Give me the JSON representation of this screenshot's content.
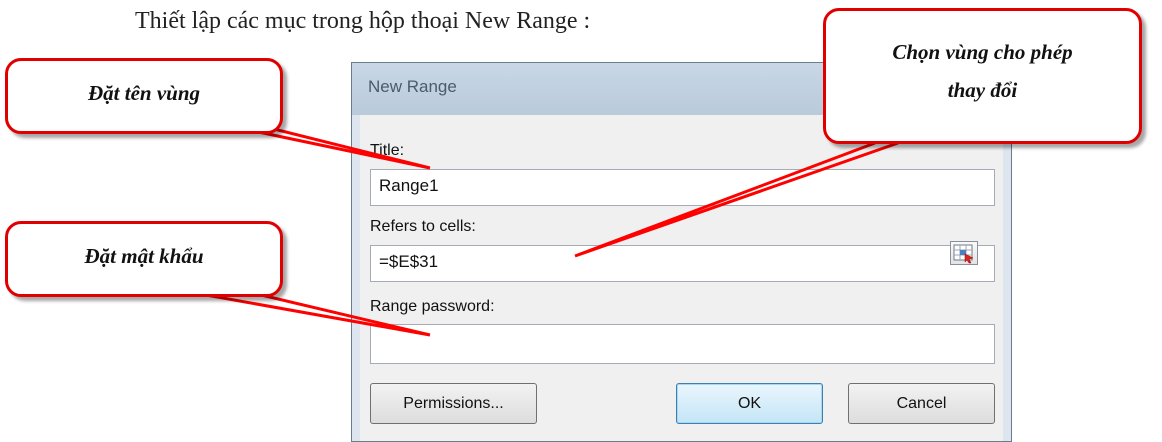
{
  "heading": "Thiết lập các mục trong hộp thoại New Range :",
  "dialog": {
    "title": "New Range",
    "title_label": "Title:",
    "title_value": "Range1",
    "refers_label": "Refers to cells:",
    "refers_value": "=$E$31",
    "password_label": "Range password:",
    "password_value": "",
    "buttons": {
      "permissions": "Permissions...",
      "ok": "OK",
      "cancel": "Cancel"
    }
  },
  "callouts": {
    "name": "Đặt tên vùng",
    "password": "Đặt mật khẩu",
    "range_line1": "Chọn vùng cho phép",
    "range_line2": "thay đổi"
  },
  "colors": {
    "callout_border": "#e10000",
    "pointer": "#ff0000"
  },
  "icons": {
    "collapse": "range-collapse-icon"
  }
}
